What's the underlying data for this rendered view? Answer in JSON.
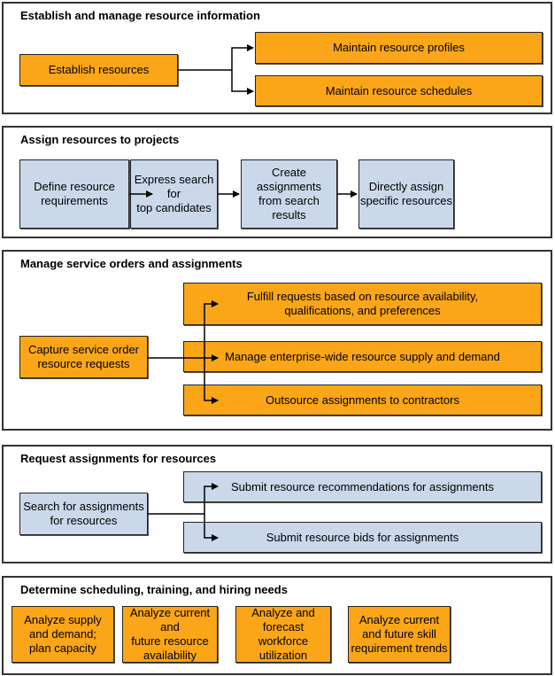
{
  "colors": {
    "process": "#fba618",
    "task": "#cad8ea",
    "border": "#333333"
  },
  "sections": [
    {
      "title": "Establish and manage resource information",
      "source": "Establish resources",
      "targets": [
        "Maintain resource profiles",
        "Maintain resource schedules"
      ]
    },
    {
      "title": "Assign resources to projects",
      "steps": [
        "Define resource\nrequirements",
        "Express search for\ntop candidates",
        "Create assignments\nfrom search results",
        "Directly assign\nspecific resources"
      ]
    },
    {
      "title": "Manage service orders and assignments",
      "source": "Capture service order\nresource requests",
      "targets": [
        "Fulfill requests based on resource availability,\nqualifications, and preferences",
        "Manage enterprise-wide resource supply and demand",
        "Outsource assignments to contractors"
      ]
    },
    {
      "title": "Request assignments for resources",
      "source": "Search for assignments\nfor resources",
      "targets": [
        "Submit resource recommendations for assignments",
        "Submit resource bids for assignments"
      ]
    },
    {
      "title": "Determine scheduling, training, and hiring needs",
      "items": [
        "Analyze supply\nand demand;\nplan capacity",
        "Analyze current and\nfuture resource\navailability",
        "Analyze and\nforecast workforce\nutilization",
        "Analyze current\nand future skill\nrequirement trends"
      ]
    }
  ]
}
